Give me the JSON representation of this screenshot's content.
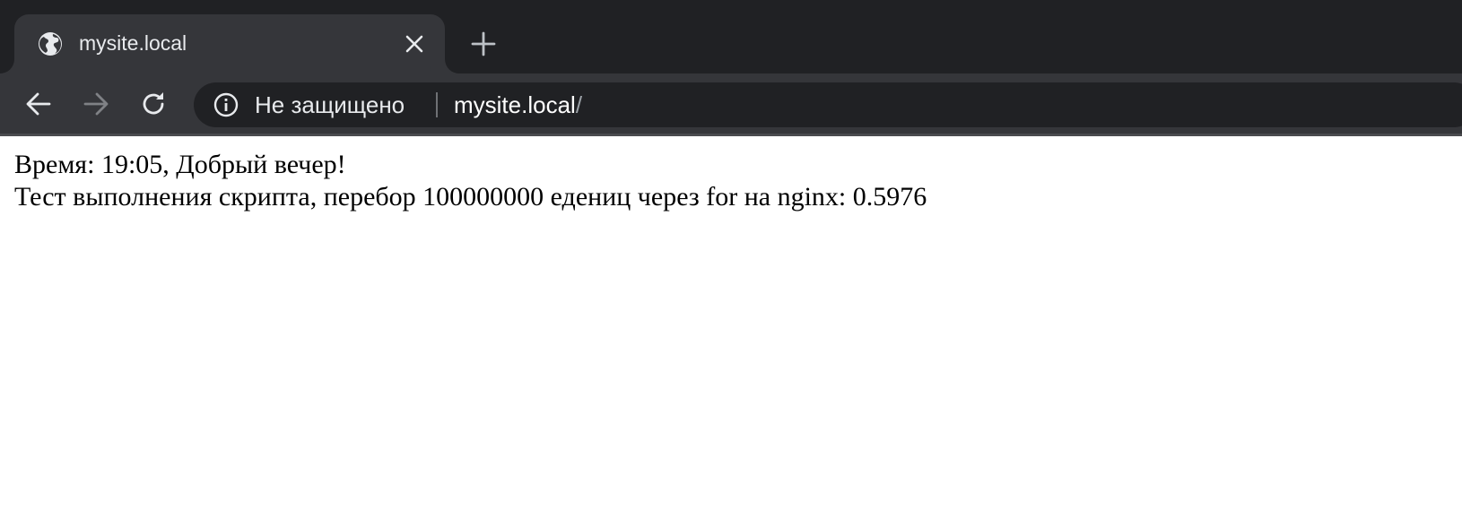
{
  "tab": {
    "title": "mysite.local",
    "icon": "globe-icon"
  },
  "toolbar": {
    "security_label": "Не защищено",
    "url_host": "mysite.local",
    "url_path": "/"
  },
  "content": {
    "lines": [
      "Время: 19:05, Добрый вечер!",
      "Тест выполнения скрипта, перебор 100000000 едениц через for на nginx: 0.5976"
    ]
  },
  "colors": {
    "tabstrip_bg": "#202124",
    "tab_bg": "#35363a",
    "omnibox_bg": "#202124",
    "text_light": "#e8eaed"
  }
}
